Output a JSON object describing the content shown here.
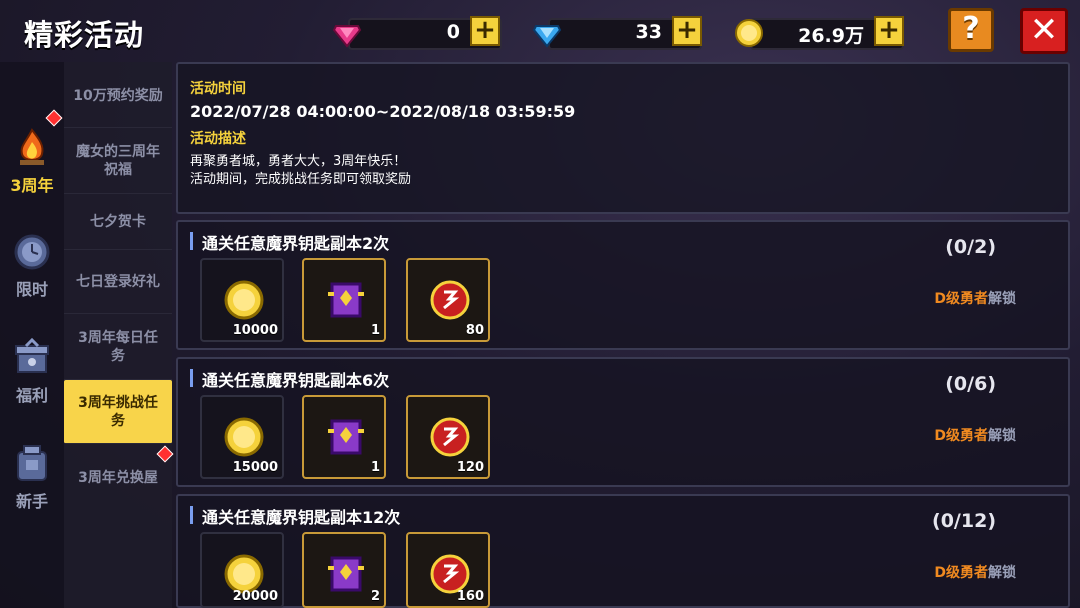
{
  "header": {
    "title": "精彩活动",
    "gems_pink": "0",
    "gems_blue": "33",
    "coins": "26.9万",
    "plus": "+",
    "help": "?",
    "close": "✕"
  },
  "categories": [
    {
      "label": "3周年",
      "icon": "campfire-icon"
    },
    {
      "label": "限时",
      "icon": "clock-icon"
    },
    {
      "label": "福利",
      "icon": "gift-icon"
    },
    {
      "label": "新手",
      "icon": "bag-icon"
    }
  ],
  "subtabs": [
    "10万预约奖励",
    "魔女的三周年祝福",
    "七夕贺卡",
    "七日登录好礼",
    "3周年每日任务",
    "3周年挑战任务",
    "3周年兑换屋"
  ],
  "info": {
    "time_heading": "活动时间",
    "time_value": "2022/07/28 04:00:00~2022/08/18 03:59:59",
    "desc_heading": "活动描述",
    "desc_line1": "再聚勇者城，勇者大大，3周年快乐！",
    "desc_line2": "活动期间，完成挑战任务即可领取奖励"
  },
  "tasks": [
    {
      "name": "通关任意魔界钥匙副本2次",
      "progress": "(0/2)",
      "level": "D级勇者",
      "unlock": "解锁",
      "rewards": [
        {
          "icon": "gold-coin-icon",
          "count": "10000"
        },
        {
          "icon": "purple-box-icon",
          "count": "1"
        },
        {
          "icon": "anniversary-token-icon",
          "count": "80"
        }
      ]
    },
    {
      "name": "通关任意魔界钥匙副本6次",
      "progress": "(0/6)",
      "level": "D级勇者",
      "unlock": "解锁",
      "rewards": [
        {
          "icon": "gold-coin-icon",
          "count": "15000"
        },
        {
          "icon": "purple-box-icon",
          "count": "1"
        },
        {
          "icon": "anniversary-token-icon",
          "count": "120"
        }
      ]
    },
    {
      "name": "通关任意魔界钥匙副本12次",
      "progress": "(0/12)",
      "level": "D级勇者",
      "unlock": "解锁",
      "rewards": [
        {
          "icon": "gold-coin-icon",
          "count": "20000"
        },
        {
          "icon": "purple-box-icon",
          "count": "2"
        },
        {
          "icon": "anniversary-token-icon",
          "count": "160"
        }
      ]
    }
  ],
  "colors": {
    "accent_yellow": "#f5d23c",
    "level_orange": "#f08a20",
    "close_red": "#d82020"
  }
}
